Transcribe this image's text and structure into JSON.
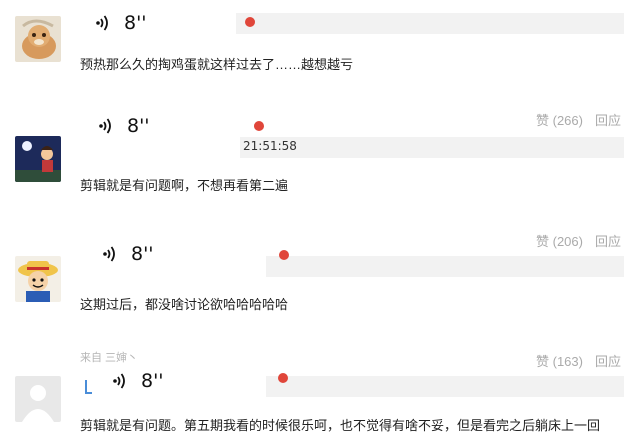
{
  "comments": [
    {
      "id": "c1",
      "voice_duration": "8''",
      "text": "预热那么久的掏鸡蛋就这样过去了……越想越亏"
    },
    {
      "id": "c2",
      "likes": "赞 (266)",
      "reply": "回应",
      "voice_duration": "8''",
      "timestamp": "21:51:58",
      "text": "剪辑就是有问题啊，不想再看第二遍"
    },
    {
      "id": "c3",
      "likes": "赞 (206)",
      "reply": "回应",
      "voice_duration": "8''",
      "text": "这期过后，都没啥讨论欲哈哈哈哈哈"
    },
    {
      "id": "c4",
      "likes": "赞 (163)",
      "reply": "回应",
      "username_partial": "来自 三婶丶",
      "voice_duration": "8''",
      "text": "剪辑就是有问题。第五期我看的时候很乐呵，也不觉得有啥不妥，但是看完之后躺床上一回"
    }
  ],
  "colors": {
    "accent": "#e0463a",
    "track": "#f2f2f2",
    "muted": "#aaaaaa"
  },
  "icons": [
    "voice-wave-icon"
  ]
}
